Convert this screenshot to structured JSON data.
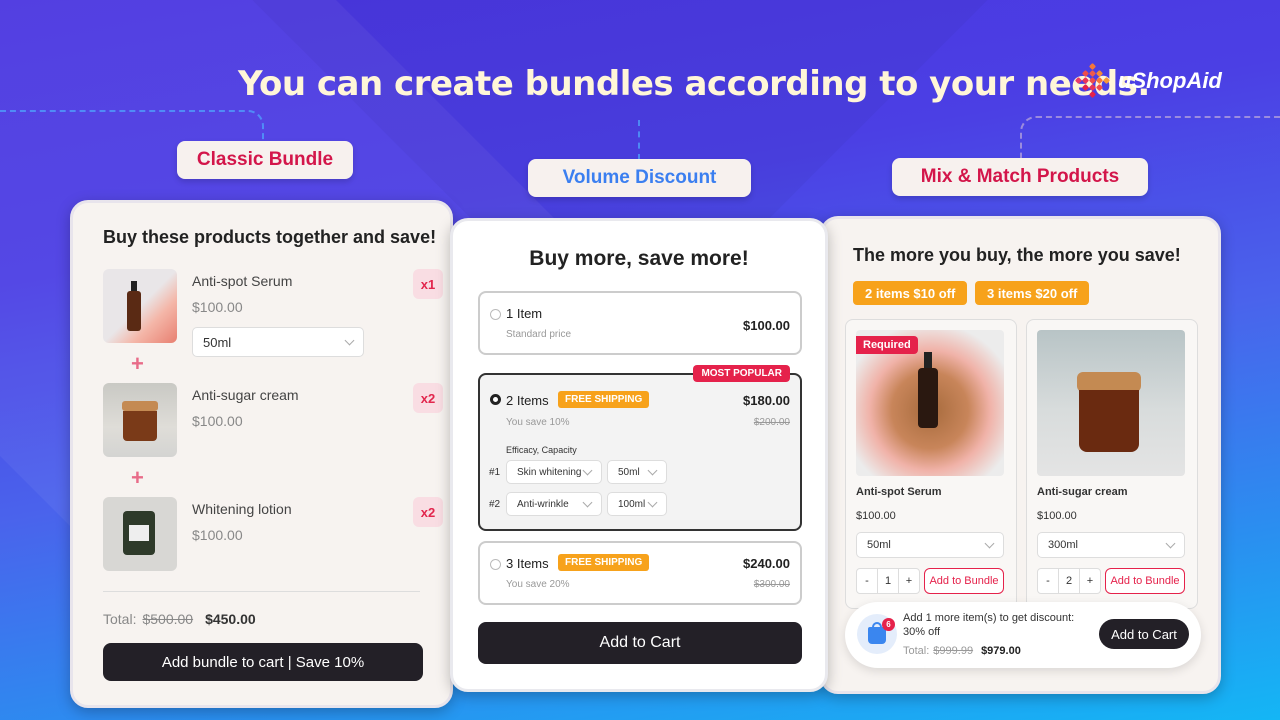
{
  "headline": "You can create bundles according to your needs.",
  "brand": {
    "name": "uShopAid",
    "accent": "#e5224b"
  },
  "tags": {
    "classic": "Classic Bundle",
    "volume": "Volume Discount",
    "mix": "Mix & Match Products"
  },
  "classic_bundle": {
    "title": "Buy these products together and save!",
    "products": [
      {
        "name": "Anti-spot Serum",
        "price": "$100.00",
        "qty": "x1",
        "variant": "50ml"
      },
      {
        "name": "Anti-sugar cream",
        "price": "$100.00",
        "qty": "x2"
      },
      {
        "name": "Whitening lotion",
        "price": "$100.00",
        "qty": "x2"
      }
    ],
    "total_label": "Total:",
    "total_original": "$500.00",
    "total_discounted": "$450.00",
    "cta": "Add bundle to cart | Save 10%"
  },
  "volume_discount": {
    "title": "Buy more, save more!",
    "options": [
      {
        "label": "1 Item",
        "sub": "Standard price",
        "price": "$100.00",
        "selected": false
      },
      {
        "label": "2 Items",
        "sub": "You save 10%",
        "price": "$180.00",
        "old_price": "$200.00",
        "badge": "FREE SHIPPING",
        "ribbon": "MOST POPULAR",
        "selected": true,
        "variant_header": "Efficacy, Capacity",
        "variants": [
          {
            "index": "#1",
            "efficacy": "Skin whitening",
            "capacity": "50ml"
          },
          {
            "index": "#2",
            "efficacy": "Anti-wrinkle",
            "capacity": "100ml"
          }
        ]
      },
      {
        "label": "3 Items",
        "sub": "You save 20%",
        "price": "$240.00",
        "old_price": "$300.00",
        "badge": "FREE SHIPPING",
        "selected": false
      }
    ],
    "cta": "Add to Cart"
  },
  "mix_match": {
    "title": "The more you buy, the more you save!",
    "tiers": [
      "2 items $10 off",
      "3 items $20 off"
    ],
    "products": [
      {
        "name": "Anti-spot Serum",
        "price": "$100.00",
        "variant": "50ml",
        "qty": "1",
        "required": "Required",
        "cta": "Add to Bundle",
        "minus": "-",
        "plus": "+"
      },
      {
        "name": "Anti-sugar cream",
        "price": "$100.00",
        "variant": "300ml",
        "qty": "2",
        "cta": "Add to Bundle",
        "minus": "-",
        "plus": "+"
      }
    ],
    "footer": {
      "cart_count": "6",
      "message": "Add 1 more item(s) to get discount: 30% off",
      "total_label": "Total:",
      "total_original": "$999.99",
      "total_discounted": "$979.00",
      "cta": "Add to Cart"
    }
  }
}
